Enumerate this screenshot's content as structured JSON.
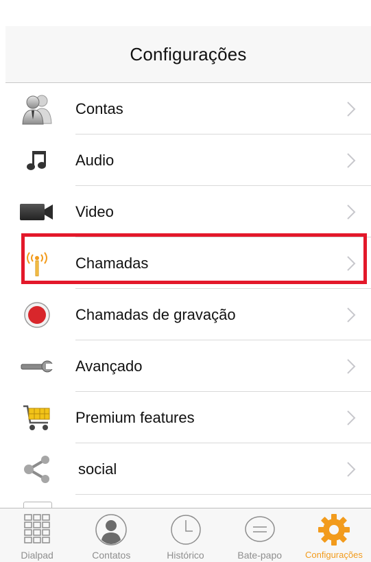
{
  "header": {
    "title": "Configurações"
  },
  "menu": [
    {
      "label": "Contas",
      "icon": "users-icon"
    },
    {
      "label": "Audio",
      "icon": "music-note-icon"
    },
    {
      "label": "Video",
      "icon": "video-camera-icon"
    },
    {
      "label": "Chamadas",
      "icon": "antenna-icon"
    },
    {
      "label": "Chamadas de gravação",
      "icon": "record-icon"
    },
    {
      "label": "Avançado",
      "icon": "wrench-icon"
    },
    {
      "label": "Premium features",
      "icon": "shopping-cart-icon"
    },
    {
      "label": "social",
      "icon": "share-icon"
    }
  ],
  "highlighted_item": "Chamadas",
  "tabs": [
    {
      "label": "Dialpad",
      "icon": "dialpad-icon",
      "active": false
    },
    {
      "label": "Contatos",
      "icon": "contact-icon",
      "active": false
    },
    {
      "label": "Histórico",
      "icon": "clock-icon",
      "active": false
    },
    {
      "label": "Bate-papo",
      "icon": "chat-bubble-icon",
      "active": false
    },
    {
      "label": "Configurações",
      "icon": "gear-icon",
      "active": true
    }
  ],
  "colors": {
    "accent": "#f29b1c",
    "highlight_border": "#e3182a",
    "record_red": "#d8262b"
  }
}
